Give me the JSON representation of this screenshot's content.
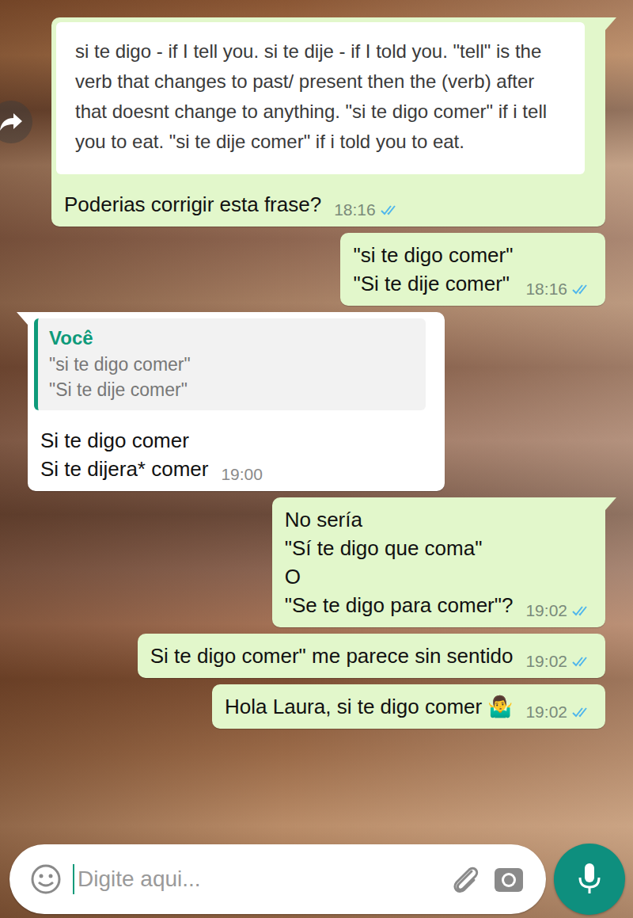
{
  "chat": {
    "messages": [
      {
        "kind": "card",
        "direction": "out",
        "tail": true,
        "card": "si te digo - if I tell you. si te dije - if I told you. \"tell\" is the verb that changes to past/ present then the (verb) after that doesnt change to anything. \"si te digo comer\" if i tell you to eat. \"si te dije comer\" if i told you to eat.",
        "lines": [
          "Poderias corrigir esta frase?"
        ],
        "time": "18:16",
        "read": true
      },
      {
        "kind": "text",
        "direction": "out",
        "tail": false,
        "lines": [
          "\"si te digo comer\"",
          "\"Si te dije comer\""
        ],
        "time": "18:16",
        "read": true
      },
      {
        "kind": "reply",
        "direction": "in",
        "tail": true,
        "quote": {
          "author": "Você",
          "lines": [
            "\"si te digo comer\"",
            "\"Si te dije comer\""
          ]
        },
        "lines": [
          "Si te digo comer",
          "Si te dijera* comer"
        ],
        "time": "19:00"
      },
      {
        "kind": "text",
        "direction": "out",
        "tail": true,
        "lines": [
          "No sería",
          "\"Sí te digo que coma\"",
          "O",
          "\"Se te digo para comer\"?"
        ],
        "time": "19:02",
        "read": true
      },
      {
        "kind": "text",
        "direction": "out",
        "tail": false,
        "lines": [
          "Si te digo comer\" me parece sin sentido"
        ],
        "time": "19:02",
        "read": true
      },
      {
        "kind": "text",
        "direction": "out",
        "tail": false,
        "lines": [
          "Hola Laura, si te digo comer 🤷‍♂️"
        ],
        "time": "19:02",
        "read": true
      }
    ]
  },
  "composer": {
    "placeholder": "Digite aqui..."
  }
}
